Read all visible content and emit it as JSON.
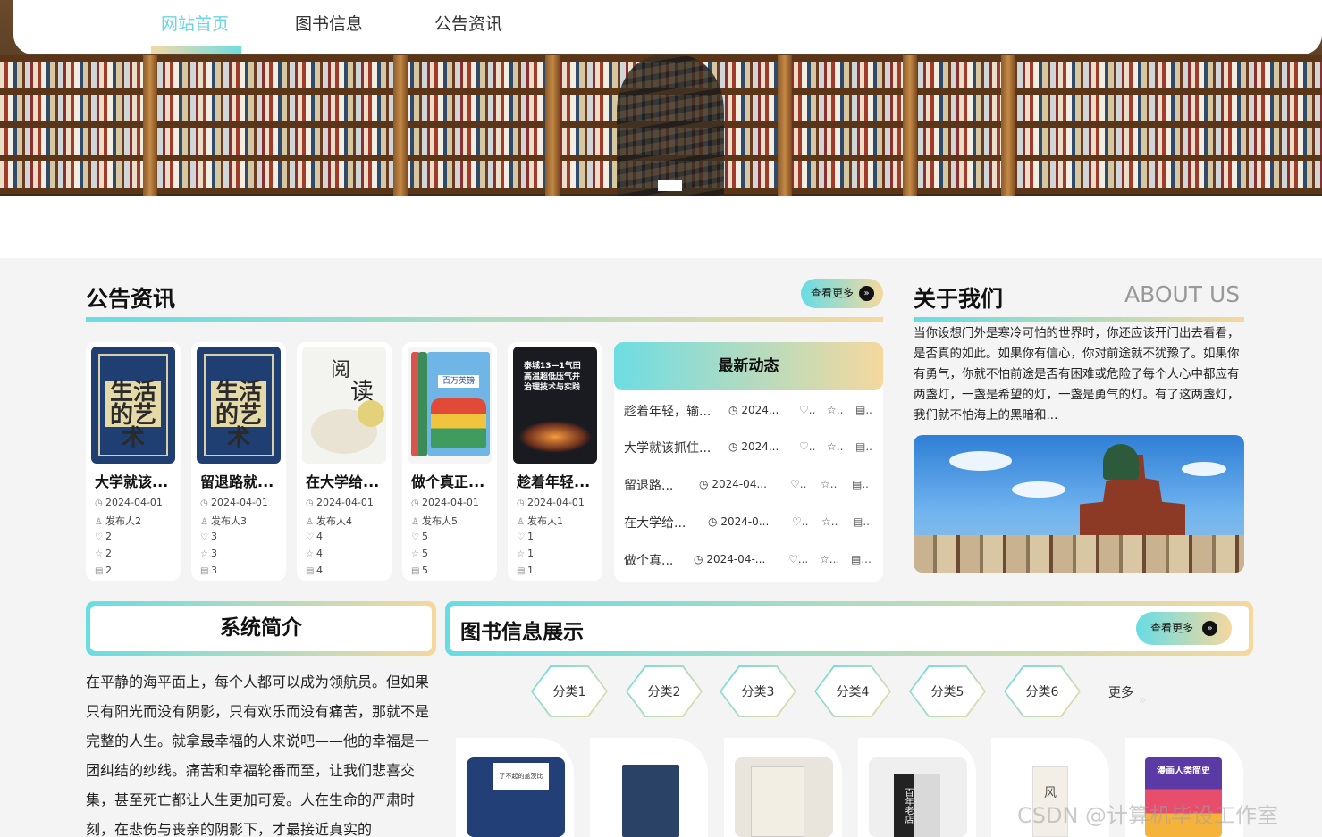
{
  "nav": {
    "items": [
      {
        "label": "网站首页",
        "active": true
      },
      {
        "label": "图书信息",
        "active": false
      },
      {
        "label": "公告资讯",
        "active": false
      }
    ]
  },
  "notice": {
    "title": "公告资讯",
    "more_label": "查看更多",
    "cards": [
      {
        "title": "大学就该...",
        "date": "2024-04-01",
        "author": "发布人2",
        "likes": "2",
        "stars": "2",
        "comments": "2"
      },
      {
        "title": "留退路就...",
        "date": "2024-04-01",
        "author": "发布人3",
        "likes": "3",
        "stars": "3",
        "comments": "3"
      },
      {
        "title": "在大学给...",
        "date": "2024-04-01",
        "author": "发布人4",
        "likes": "4",
        "stars": "4",
        "comments": "4"
      },
      {
        "title": "做个真正...",
        "date": "2024-04-01",
        "author": "发布人5",
        "likes": "5",
        "stars": "5",
        "comments": "5"
      },
      {
        "title": "趁着年轻...",
        "date": "2024-04-01",
        "author": "发布人1",
        "likes": "1",
        "stars": "1",
        "comments": "1"
      }
    ],
    "covers": {
      "c1": "生活的艺术",
      "c3a": "阅",
      "c3b": "读",
      "c4": "百万英镑",
      "c5": "泰城13—1气田 高温超低压气井 治理技术与实践"
    }
  },
  "latest": {
    "title": "最新动态",
    "items": [
      {
        "title": "趁着年轻，输...",
        "date": "2024...",
        "likes": "..",
        "stars": "..",
        "comments": ".."
      },
      {
        "title": "大学就该抓住...",
        "date": "2024...",
        "likes": "..",
        "stars": "..",
        "comments": ".."
      },
      {
        "title": "留退路...",
        "date": "2024-04...",
        "likes": "..",
        "stars": "..",
        "comments": ".."
      },
      {
        "title": "在大学给...",
        "date": "2024-0...",
        "likes": "..",
        "stars": "..",
        "comments": ".."
      },
      {
        "title": "做个真...",
        "date": "2024-04-...",
        "likes": "...",
        "stars": "...",
        "comments": "..."
      }
    ]
  },
  "about": {
    "title": "关于我们",
    "title_en": "ABOUT US",
    "text": "当你设想门外是寒冷可怕的世界时，你还应该开门出去看看，是否真的如此。如果你有信心，你对前途就不犹豫了。如果你有勇气，你就不怕前途是否有困难或危险了每个人心中都应有两盏灯，一盏是希望的灯，一盏是勇气的灯。有了这两盏灯，我们就不怕海上的黑暗和..."
  },
  "intro": {
    "title": "系统简介",
    "text": "在平静的海平面上，每个人都可以成为领航员。但如果只有阳光而没有阴影，只有欢乐而没有痛苦，那就不是完整的人生。就拿最幸福的人来说吧——他的幸福是一团纠结的纱线。痛苦和幸福轮番而至，让我们悲喜交集，甚至死亡都让人生更加可爱。人在生命的严肃时刻，在悲伤与丧亲的阴影下，才最接近真实的"
  },
  "books": {
    "title": "图书信息展示",
    "more_label": "查看更多",
    "categories": [
      "分类1",
      "分类2",
      "分类3",
      "分类4",
      "分类5",
      "分类6"
    ],
    "more_categories": "更多",
    "covers": [
      "了不起的盖茨比",
      "",
      "",
      "百年老店",
      "风",
      "漫画人类简史"
    ]
  },
  "watermark": "CSDN @计算机毕设工作室",
  "colors": {
    "accent": "#69d6df",
    "gradient_start": "#67dde4",
    "gradient_end": "#f5d89e"
  }
}
